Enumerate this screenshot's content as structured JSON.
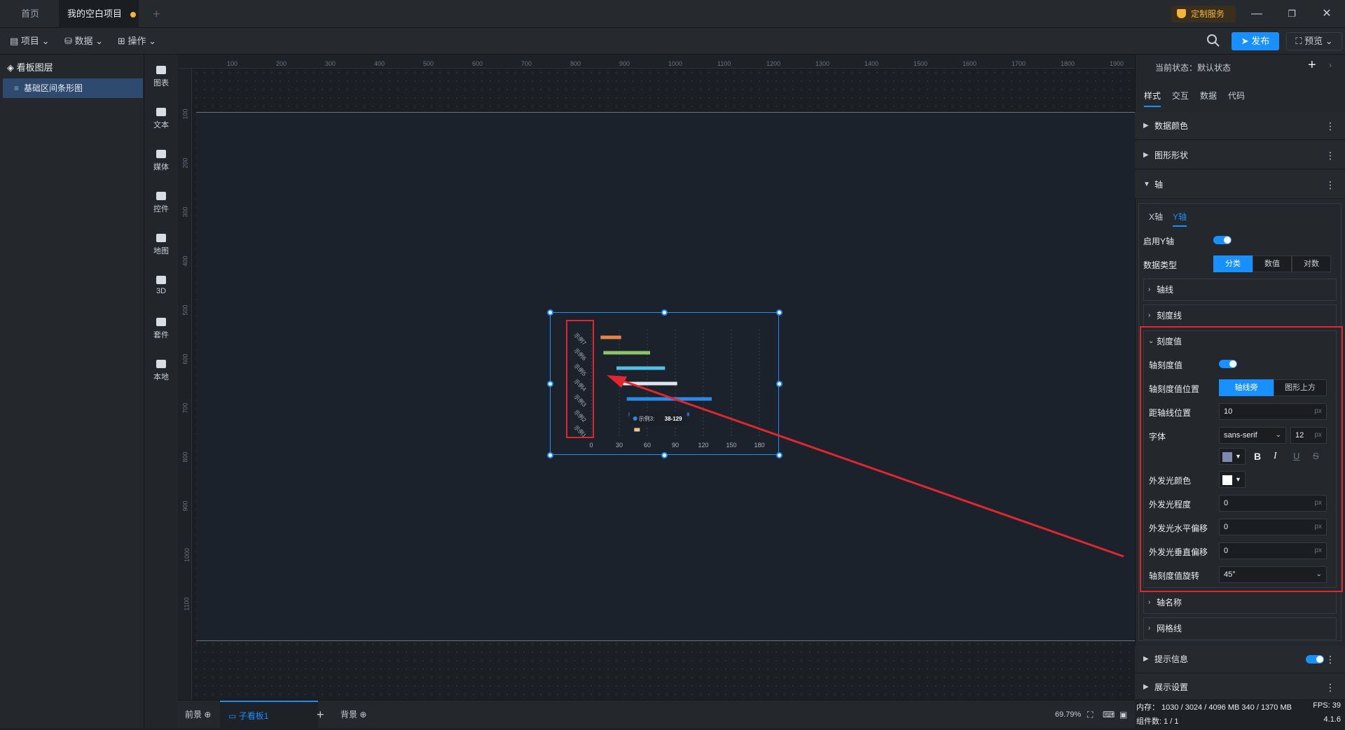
{
  "tabs": {
    "home": "首页",
    "project": "我的空白项目",
    "custom_service": "定制服务"
  },
  "menu": {
    "project": "项目",
    "data": "数据",
    "operate": "操作",
    "publish": "发布",
    "preview": "预览"
  },
  "layers": {
    "title": "看板图层",
    "item": "基础区间条形图"
  },
  "toolbox": [
    {
      "label": "图表",
      "icon": "chart-icon"
    },
    {
      "label": "文本",
      "icon": "text-icon"
    },
    {
      "label": "媒体",
      "icon": "media-icon"
    },
    {
      "label": "控件",
      "icon": "control-icon"
    },
    {
      "label": "地图",
      "icon": "map-icon"
    },
    {
      "label": "3D",
      "icon": "cube-icon"
    },
    {
      "label": "套件",
      "icon": "kit-icon"
    },
    {
      "label": "本地",
      "icon": "puzzle-icon"
    }
  ],
  "ruler": {
    "top": [
      "100",
      "200",
      "300",
      "400",
      "500",
      "600",
      "700",
      "800",
      "900",
      "1000",
      "1100",
      "1200",
      "1300",
      "1400",
      "1500",
      "1600",
      "1700",
      "1800",
      "1900"
    ],
    "left": [
      "100",
      "200",
      "300",
      "400",
      "500",
      "600",
      "700",
      "800",
      "900",
      "1000",
      "1100"
    ]
  },
  "chart_data": {
    "type": "bar",
    "categories": [
      "示例7",
      "示例6",
      "示例5",
      "示例4",
      "示例3",
      "示例2",
      "示例1"
    ],
    "x_ticks": [
      "0",
      "30",
      "60",
      "90",
      "120",
      "150",
      "180"
    ],
    "xlim": [
      0,
      180
    ],
    "series": [
      {
        "ranges": [
          [
            10,
            32
          ],
          [
            13,
            63
          ],
          [
            27,
            79
          ],
          [
            34,
            92
          ],
          [
            38,
            129
          ],
          [
            40,
            105
          ],
          [
            46,
            52
          ]
        ],
        "colors": [
          "#e8834a",
          "#8dc36a",
          "#4fc0e6",
          "#dfe6f1",
          "#2b8ae8",
          "#1e6fc7",
          "#f0c58a"
        ]
      }
    ],
    "tooltip": {
      "label": "示例3:",
      "value": "38-129"
    }
  },
  "bottom": {
    "foreground": "前景",
    "subboard": "子看板1",
    "background": "背景",
    "zoom": "69.79%"
  },
  "right": {
    "state_label": "当前状态：默认状态",
    "tabs": [
      "样式",
      "交互",
      "数据",
      "代码"
    ],
    "sections": {
      "data_color": "数据颜色",
      "shape": "图形形状",
      "axis": "轴",
      "tooltip": "提示信息",
      "display": "展示设置"
    },
    "axis_tabs": [
      "X轴",
      "Y轴"
    ],
    "enable_y": "启用Y轴",
    "data_type": "数据类型",
    "data_type_opts": [
      "分类",
      "数值",
      "对数"
    ],
    "axis_line": "轴线",
    "tick_line": "刻度线",
    "tick_value": "刻度值",
    "axis_tick_value": "轴刻度值",
    "tick_pos": "轴刻度值位置",
    "tick_pos_opts": [
      "轴线旁",
      "图形上方"
    ],
    "dist": "距轴线位置",
    "dist_val": "10",
    "font": "字体",
    "font_val": "sans-serif",
    "font_size": "12",
    "glow_color": "外发光颜色",
    "glow_level": "外发光程度",
    "glow_level_val": "0",
    "glow_h": "外发光水平偏移",
    "glow_h_val": "0",
    "glow_v": "外发光垂直偏移",
    "glow_v_val": "0",
    "rotate": "轴刻度值旋转",
    "rotate_val": "45°",
    "axis_name": "轴名称",
    "grid": "网格线",
    "unit": "px"
  },
  "status": {
    "memory": "内存： 1030 / 3024 / 4096 MB  340 / 1370 MB",
    "fps": "FPS:  39",
    "count": "组件数: 1 / 1",
    "version": "4.1.6"
  }
}
